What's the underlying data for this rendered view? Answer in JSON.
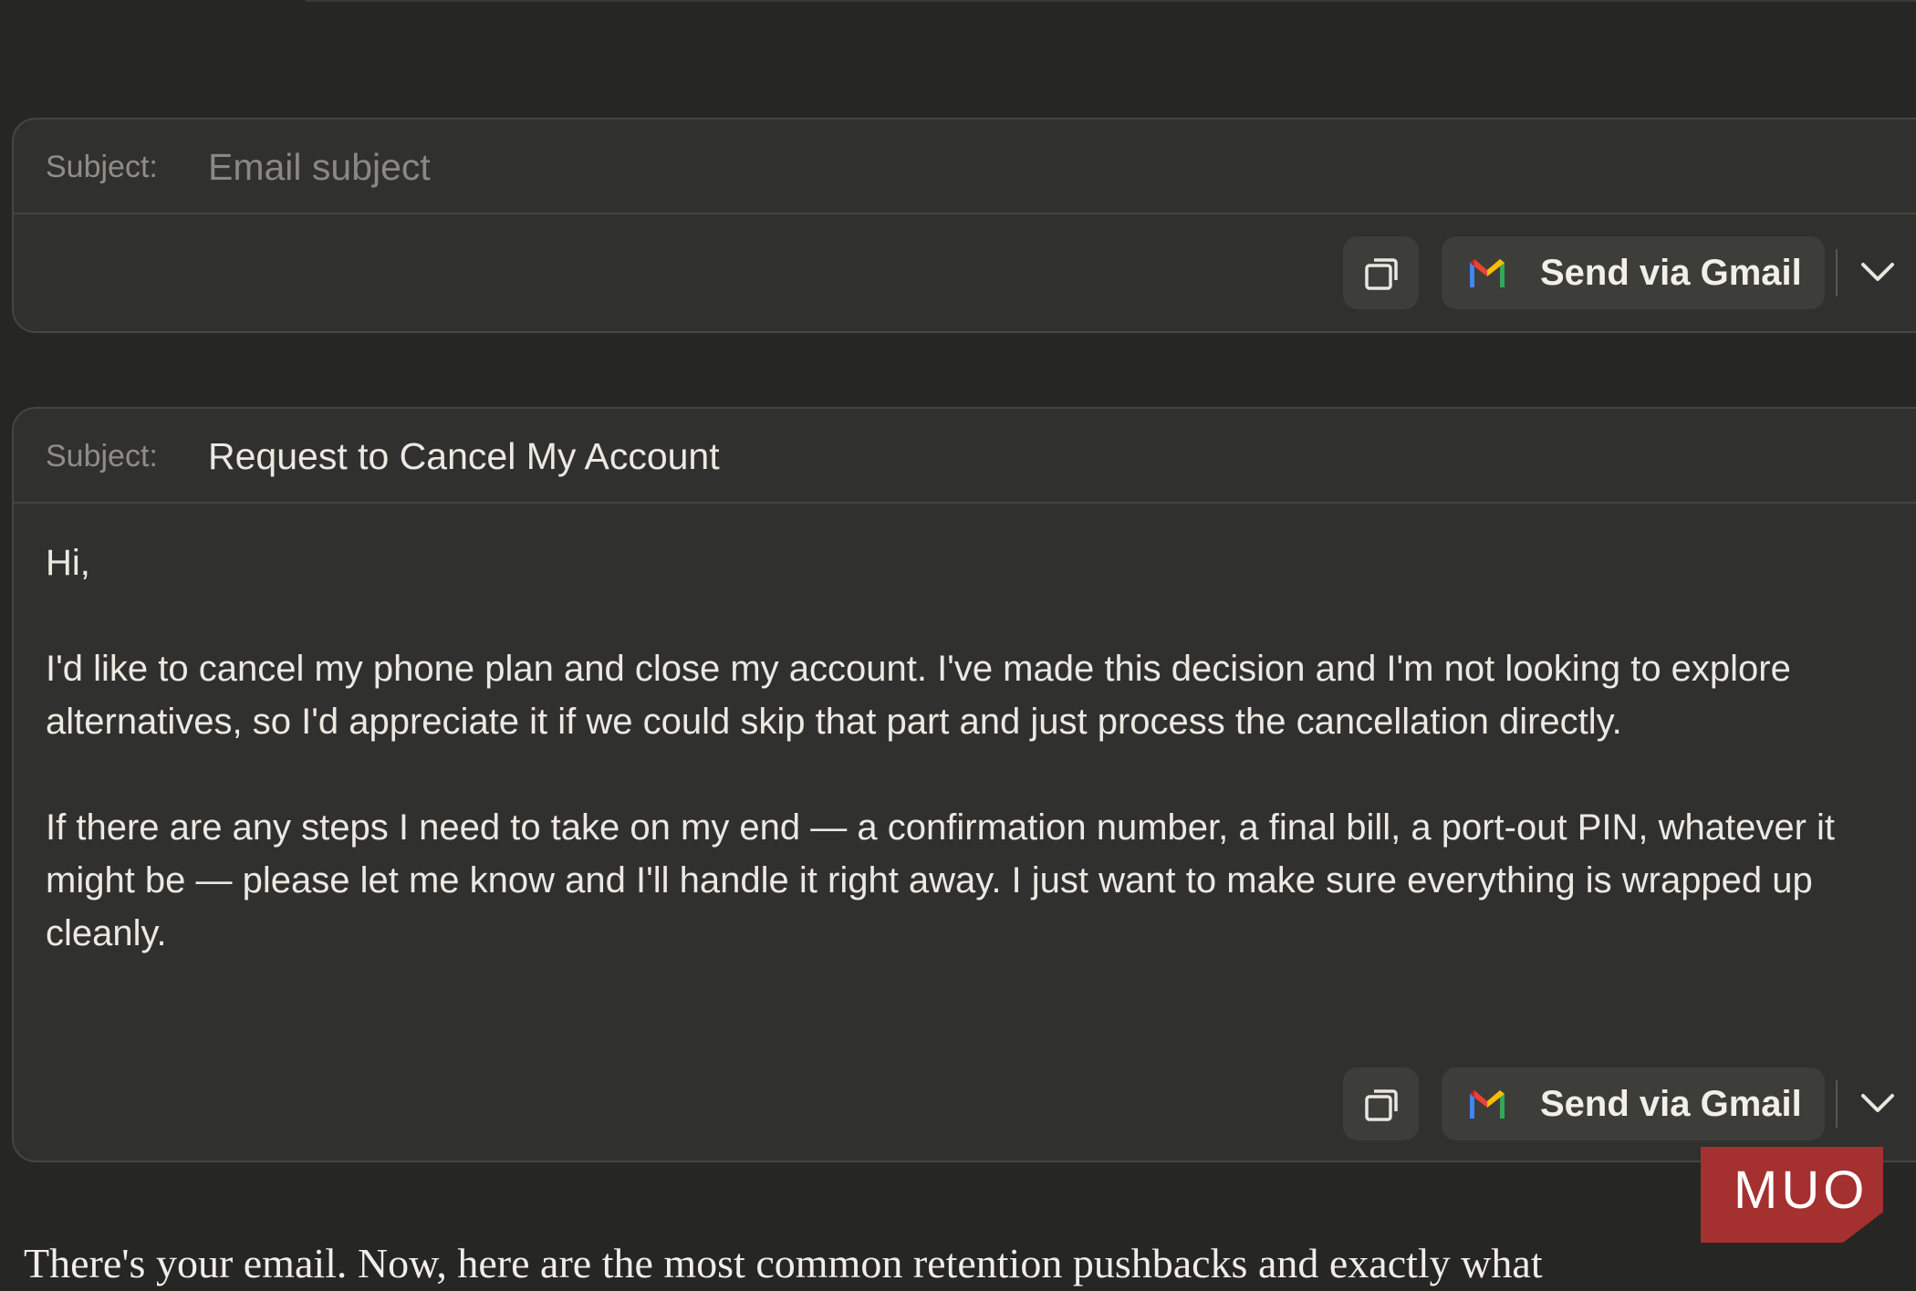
{
  "first_email": {
    "subject_label": "Subject:",
    "subject_placeholder": "Email subject",
    "send_label": "Send via Gmail"
  },
  "second_email": {
    "subject_label": "Subject:",
    "subject_value": "Request to Cancel My Account",
    "body": [
      "Hi,",
      "I'd like to cancel my phone plan and close my account. I've made this decision and I'm not looking to explore alternatives, so I'd appreciate it if we could skip that part and just process the cancellation directly.",
      "If there are any steps I need to take on my end — a confirmation number, a final bill, a port-out PIN, whatever it might be — please let me know and I'll handle it right away. I just want to make sure everything is wrapped up cleanly."
    ],
    "send_label": "Send via Gmail"
  },
  "footer_text": "There's your email. Now, here are the most common retention pushbacks and exactly what",
  "watermark_text": "MUO",
  "icons": {
    "copy": "copy-icon",
    "gmail": "gmail-icon",
    "dropdown": "chevron-down-icon"
  },
  "colors": {
    "page_background": "#262624",
    "card_background": "#30302e",
    "button_background": "#3d3d3a",
    "text_primary": "#ece9e2",
    "text_muted": "#8f8d86",
    "watermark": "#a4302f"
  }
}
